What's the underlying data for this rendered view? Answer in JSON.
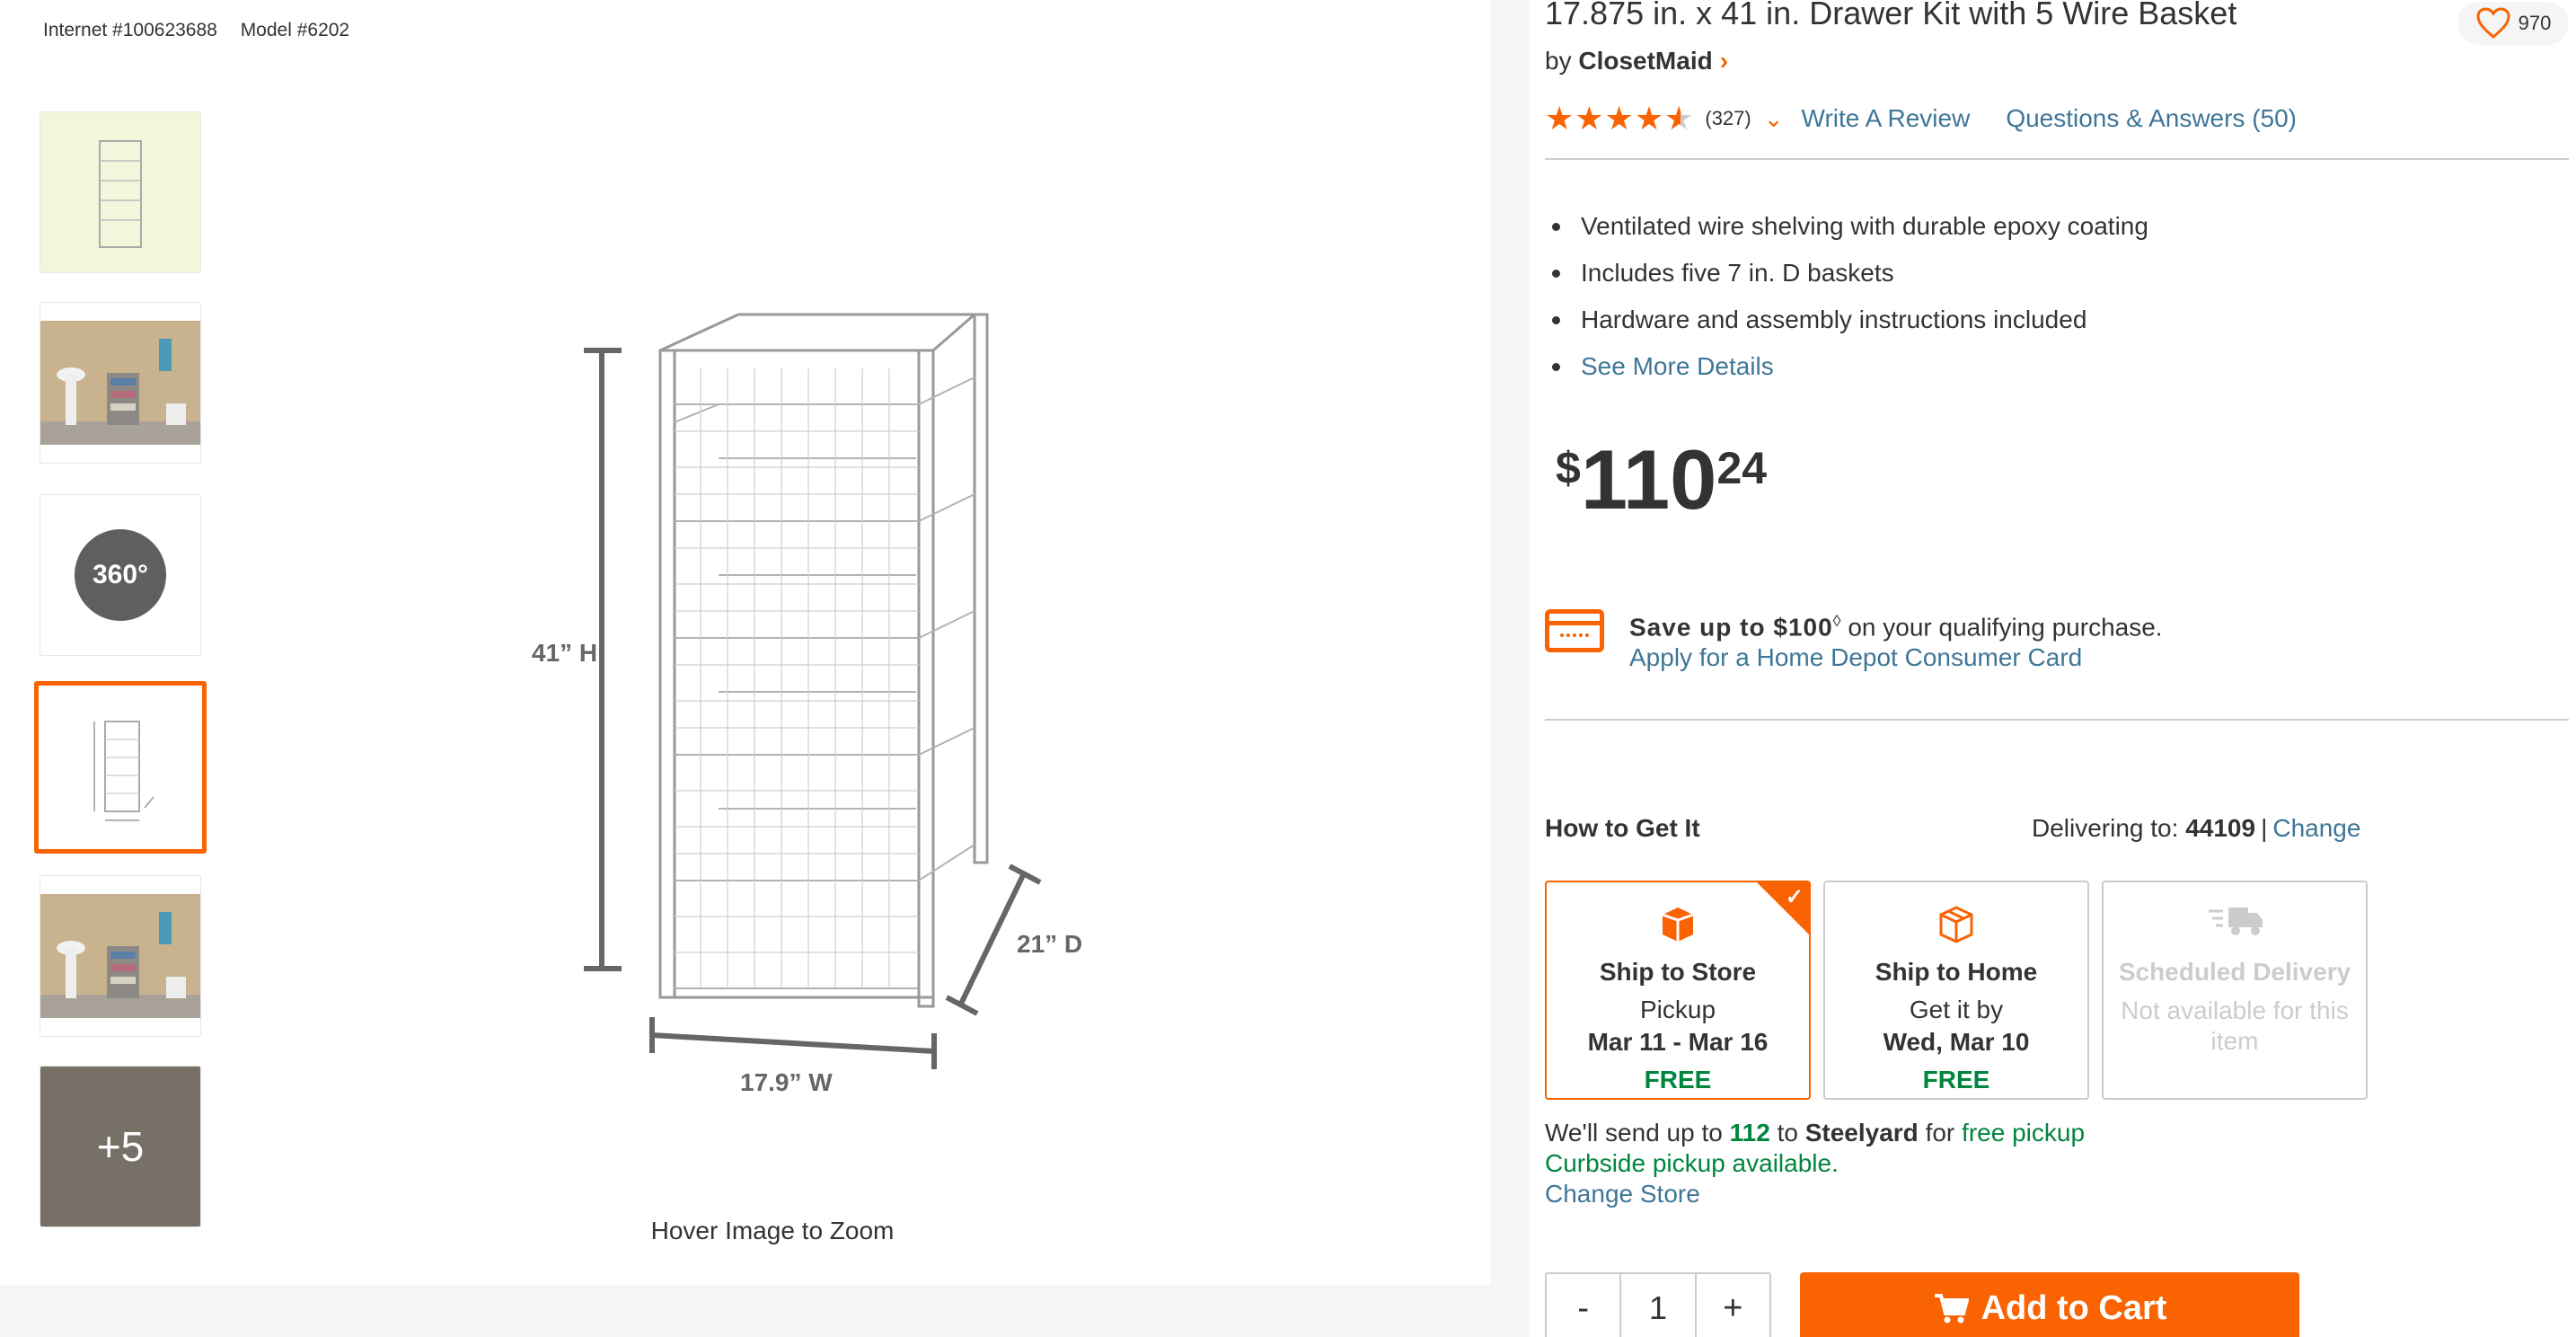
{
  "product": {
    "internet_number": "Internet #100623688",
    "model_number": "Model #6202",
    "title": "17.875 in. x 41 in. Drawer Kit with 5 Wire Basket",
    "brand_prefix": "by",
    "brand": "ClosetMaid",
    "favorites_count": "970",
    "rating": 4.5,
    "review_count": "(327)",
    "write_review": "Write A Review",
    "questions_answers": "Questions & Answers (50)"
  },
  "gallery": {
    "thumb_360_label": "360°",
    "more_label": "+5",
    "hover_zoom": "Hover Image to Zoom",
    "dimensions": {
      "height": "41” H",
      "width": "17.9” W",
      "depth": "21” D"
    }
  },
  "highlights": [
    "Ventilated wire shelving with durable epoxy coating",
    "Includes five 7 in. D baskets",
    "Hardware and assembly instructions included"
  ],
  "see_more": "See More Details",
  "price": {
    "currency": "$",
    "dollars": "110",
    "cents": "24"
  },
  "promo": {
    "save_text": "Save up to $100",
    "superscript": "◊",
    "rest": " on your qualifying purchase.",
    "apply_link": "Apply for a Home Depot Consumer Card"
  },
  "fulfillment": {
    "heading": "How to Get It",
    "delivering_label": "Delivering to:",
    "zip": "44109",
    "change": "Change",
    "options": [
      {
        "name": "Ship to Store",
        "sub": "Pickup",
        "date": "Mar 11 - Mar 16",
        "price": "FREE"
      },
      {
        "name": "Ship to Home",
        "sub": "Get it by",
        "date": "Wed, Mar 10",
        "price": "FREE"
      },
      {
        "name": "Scheduled Delivery",
        "sub": "Not available for this item"
      }
    ],
    "pickup_prefix": "We'll send up to",
    "pickup_qty": "112",
    "pickup_to": "to",
    "store_name": "Steelyard",
    "pickup_for": "for",
    "free_pickup": "free pickup",
    "curbside": "Curbside pickup available.",
    "change_store": "Change Store"
  },
  "cart": {
    "minus": "-",
    "quantity": "1",
    "plus": "+",
    "add_to_cart": "Add to Cart"
  },
  "colors": {
    "accent": "#f96302",
    "link": "#3e7697",
    "success": "#00853e"
  }
}
